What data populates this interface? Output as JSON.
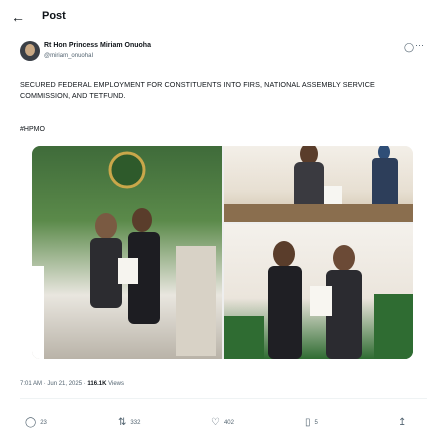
{
  "header": {
    "title": "Post",
    "back_icon": "arrow-left-icon"
  },
  "author": {
    "name": "Rt Hon Princess Miriam Onuoha",
    "handle": "@miriam_onuohaI"
  },
  "post": {
    "text": "SECURED FEDERAL EMPLOYMENT FOR CONSTITUENTS INTO FIRS, NATIONAL ASSEMBLY SERVICE COMMISSION, AND TETFUND.",
    "hashtag": "#HPMO"
  },
  "meta": {
    "time": "7:01 AM",
    "date": "Jun 21, 2025",
    "views_count": "116.1K",
    "views_label": "Views"
  },
  "actions": {
    "replies": "23",
    "reposts": "332",
    "likes": "402",
    "views": "5"
  },
  "colors": {
    "secondary_text": "#536471",
    "divider": "#eff3f4"
  }
}
